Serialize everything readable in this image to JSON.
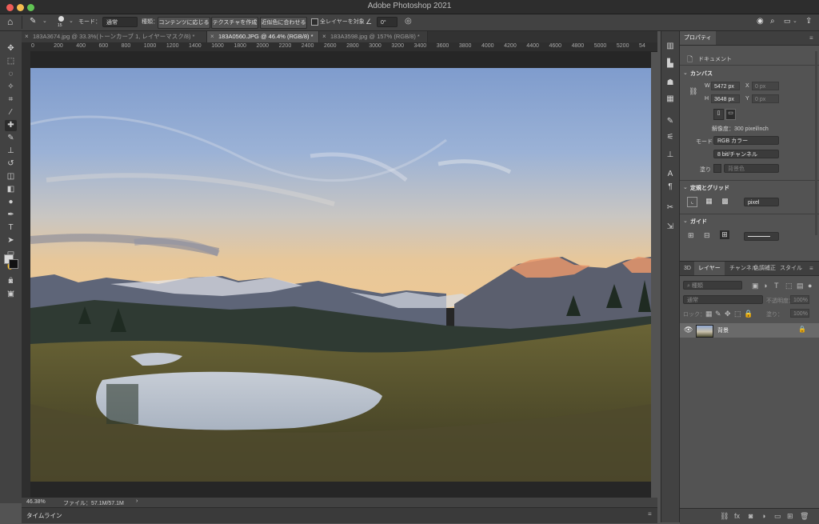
{
  "app": {
    "title": "Adobe Photoshop 2021"
  },
  "options": {
    "brush_size": "15",
    "mode_label": "モード：",
    "mode_value": "通常",
    "type_label": "種類：",
    "btn_content_aware": "コンテンツに応じる",
    "btn_create_texture": "テクスチャを作成",
    "btn_proximity_match": "近似色に合わせる",
    "sample_all_layers": "全レイヤーを対象",
    "angle_value": "0°"
  },
  "tabs": [
    {
      "label": "183A3674.jpg @ 33.3%(トーンカーブ 1, レイヤーマスク/8) *",
      "active": false
    },
    {
      "label": "183A0560.JPG @ 46.4% (RGB/8) *",
      "active": true
    },
    {
      "label": "183A3598.jpg @ 157% (RGB/8) *",
      "active": false
    }
  ],
  "ruler": {
    "ticks": [
      "0",
      "200",
      "400",
      "600",
      "800",
      "1000",
      "1200",
      "1400",
      "1600",
      "1800",
      "2000",
      "2200",
      "2400",
      "2600",
      "2800",
      "3000",
      "3200",
      "3400",
      "3600",
      "3800",
      "4000",
      "4200",
      "4400",
      "4600",
      "4800",
      "5000",
      "5200",
      "54"
    ]
  },
  "status": {
    "zoom": "46.38%",
    "file_info": "ファイル：57.1M/57.1M",
    "arrow": "›"
  },
  "timeline": {
    "label": "タイムライン"
  },
  "properties": {
    "tab": "プロパティ",
    "doc_label": "ドキュメント",
    "canvas_section": "カンバス",
    "w_label": "W",
    "w_value": "5472 px",
    "h_label": "H",
    "h_value": "3648 px",
    "x_label": "X",
    "x_value": "0 px",
    "y_label": "Y",
    "y_value": "0 px",
    "resolution": "解像度：300 pixel/inch",
    "mode_label": "モード",
    "mode_value": "RGB カラー",
    "depth_value": "8 bit/チャンネル",
    "fill_label": "塗り",
    "fill_value": "背景色",
    "rulers_section": "定規とグリッド",
    "units_value": "pixel",
    "guides_section": "ガイド"
  },
  "layers_panel": {
    "tabs": [
      "3D",
      "レイヤー",
      "チャンネル",
      "色調補正",
      "スタイル"
    ],
    "active_tab": "レイヤー",
    "search_placeholder": "種類",
    "blend_mode": "通常",
    "opacity_label": "不透明度：",
    "opacity_value": "100%",
    "lock_label": "ロック：",
    "fill_label": "塗り：",
    "fill_value": "100%",
    "layer_name": "背景"
  },
  "colors": {
    "accent": "#3b8ee0",
    "panel_bg": "#535353",
    "dark_bg": "#2d2d2d",
    "toolbar_bg": "#424242"
  }
}
